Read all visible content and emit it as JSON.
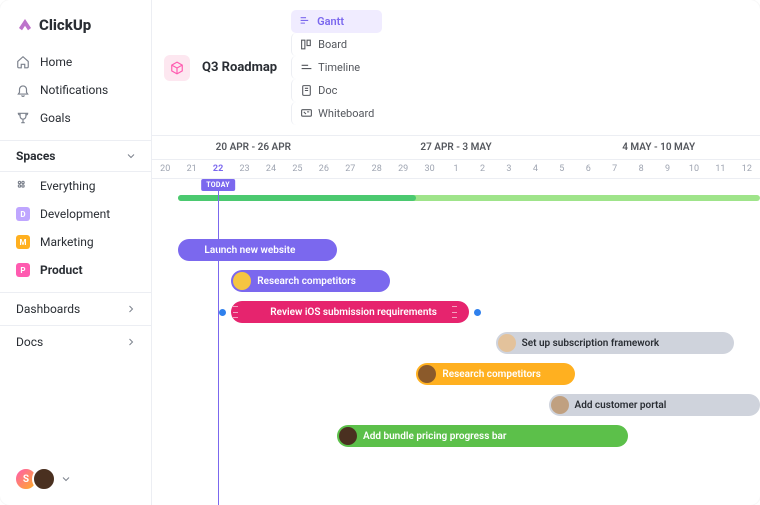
{
  "brand": "ClickUp",
  "nav": {
    "home": "Home",
    "notifications": "Notifications",
    "goals": "Goals"
  },
  "spacesHeader": "Spaces",
  "spaces": {
    "everything": "Everything",
    "items": [
      {
        "initial": "D",
        "label": "Development",
        "color": "#bfa6ff"
      },
      {
        "initial": "M",
        "label": "Marketing",
        "color": "#ffb020"
      },
      {
        "initial": "P",
        "label": "Product",
        "color": "#ff5bb0",
        "active": true
      }
    ]
  },
  "dashboards": "Dashboards",
  "docs": "Docs",
  "project": {
    "title": "Q3 Roadmap"
  },
  "views": [
    {
      "label": "Gantt",
      "active": true
    },
    {
      "label": "Board"
    },
    {
      "label": "Timeline"
    },
    {
      "label": "Doc"
    },
    {
      "label": "Whiteboard"
    }
  ],
  "weeks": [
    "20 APR - 26 APR",
    "27 APR - 3 MAY",
    "4 MAY - 10 MAY"
  ],
  "days": [
    "20",
    "21",
    "22",
    "23",
    "24",
    "25",
    "26",
    "27",
    "28",
    "29",
    "30",
    "1",
    "2",
    "3",
    "4",
    "5",
    "6",
    "7",
    "8",
    "9",
    "10",
    "11",
    "12"
  ],
  "todayIndex": 2,
  "todayLabel": "TODAY",
  "overallBar": {
    "startDay": 1,
    "endDay": 23,
    "progressDay": 10,
    "bg": "#9fe48a",
    "progress": "#4bc970"
  },
  "tasks": [
    {
      "label": "Launch new website",
      "startDay": 1,
      "endDay": 7,
      "color": "#7b68ee",
      "avatar": "#7b68ee"
    },
    {
      "label": "Research competitors",
      "startDay": 3,
      "endDay": 9,
      "color": "#7b68ee",
      "avatar": "#f5c542"
    },
    {
      "label": "Review iOS submission requirements",
      "startDay": 3,
      "endDay": 12,
      "color": "#e6246e",
      "avatar": "#e6246e",
      "grip": true,
      "preDot": "#2f80ed",
      "postDot": "#2f80ed"
    },
    {
      "label": "Set up subscription framework",
      "startDay": 13,
      "endDay": 22,
      "color": "#cfd3dc",
      "text": "#2a2e34",
      "avatar": "#e3c29b"
    },
    {
      "label": "Research competitors",
      "startDay": 10,
      "endDay": 16,
      "color": "#ffb020",
      "avatar": "#8b5a2b"
    },
    {
      "label": "Add customer portal",
      "startDay": 15,
      "endDay": 23,
      "color": "#cfd3dc",
      "text": "#2a2e34",
      "avatar": "#c0a080"
    },
    {
      "label": "Add bundle pricing progress bar",
      "startDay": 7,
      "endDay": 18,
      "color": "#5cc04a",
      "avatar": "#4a3020"
    }
  ],
  "userAvatars": [
    {
      "label": "S",
      "bg": "linear-gradient(135deg,#ff5bb0,#ffb020)"
    },
    {
      "label": "",
      "bg": "#4a3020"
    }
  ]
}
